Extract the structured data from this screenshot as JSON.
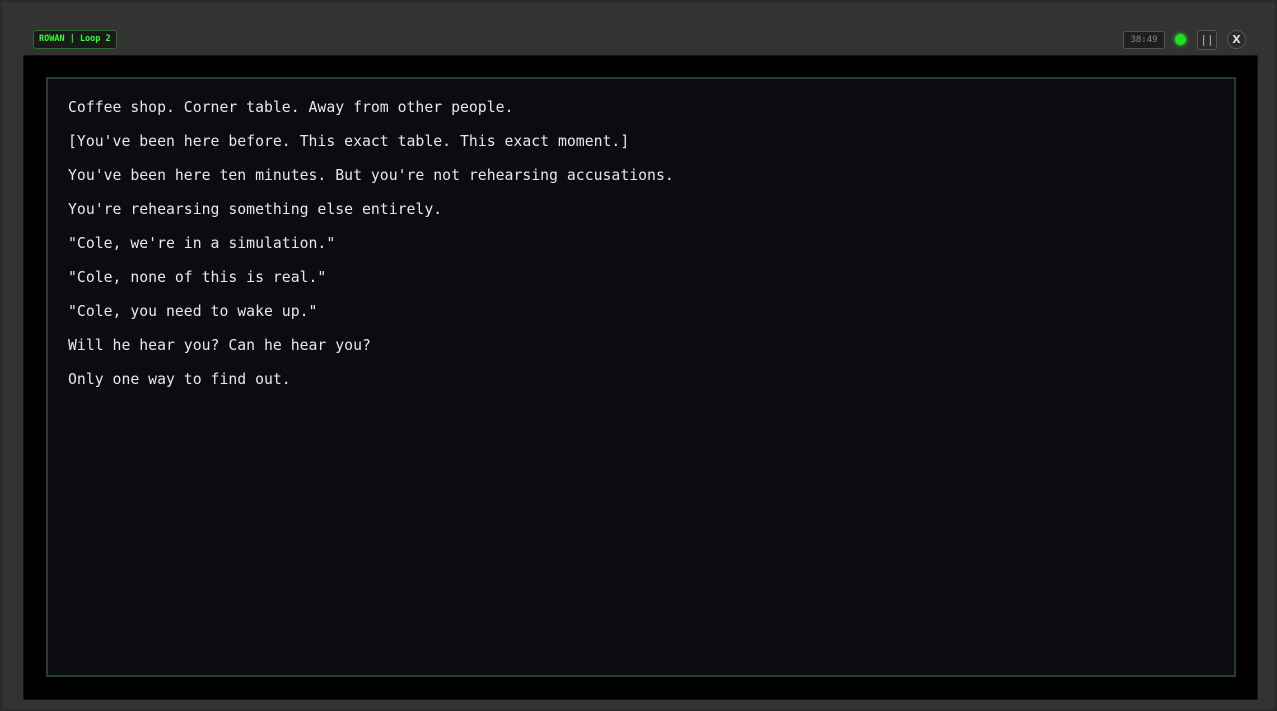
{
  "header": {
    "badge": "ROWAN | Loop 2",
    "timer": "38:49",
    "status_color": "#22dd22",
    "pause_icon": "pause-icon",
    "pause_label": "||",
    "close_icon": "close-icon",
    "close_label": "X"
  },
  "story": {
    "lines": [
      "Coffee shop. Corner table. Away from other people.",
      "[You've been here before. This exact table. This exact moment.]",
      "You've been here ten minutes. But you're not rehearsing accusations.",
      "You're rehearsing something else entirely.",
      "\"Cole, we're in a simulation.\"",
      "\"Cole, none of this is real.\"",
      "\"Cole, you need to wake up.\"",
      "Will he hear you? Can he hear you?",
      "Only one way to find out."
    ]
  },
  "colors": {
    "accent": "#33ff33",
    "text": "#e8e8e8",
    "terminal_bg": "#0b0c10",
    "terminal_border": "#27402a"
  }
}
